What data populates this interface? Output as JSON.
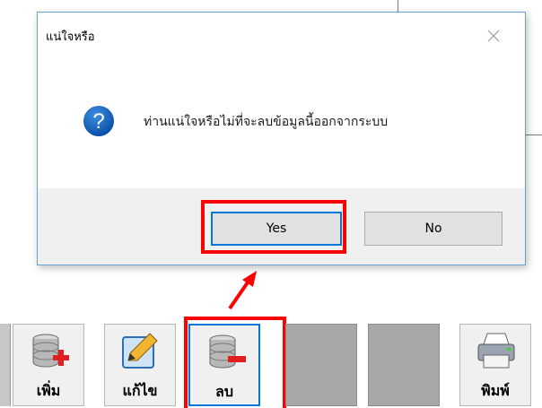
{
  "dialog": {
    "title": "แน่ใจหรือ",
    "message": "ท่านแน่ใจหรือไม่ที่จะลบข้อมูลนี้ออกจากระบบ",
    "yes_label": "Yes",
    "no_label": "No",
    "icon": "question-icon",
    "accent_color": "#0078d7"
  },
  "toolbar": {
    "items": [
      {
        "label": "เพิ่ม",
        "icon": "database-add-icon"
      },
      {
        "label": "แก้ไข",
        "icon": "edit-pencil-icon"
      },
      {
        "label": "ลบ",
        "icon": "database-remove-icon"
      },
      {
        "label": "",
        "icon": ""
      },
      {
        "label": "",
        "icon": ""
      },
      {
        "label": "พิมพ์",
        "icon": "printer-icon"
      }
    ]
  },
  "highlight_color": "#ff0000"
}
